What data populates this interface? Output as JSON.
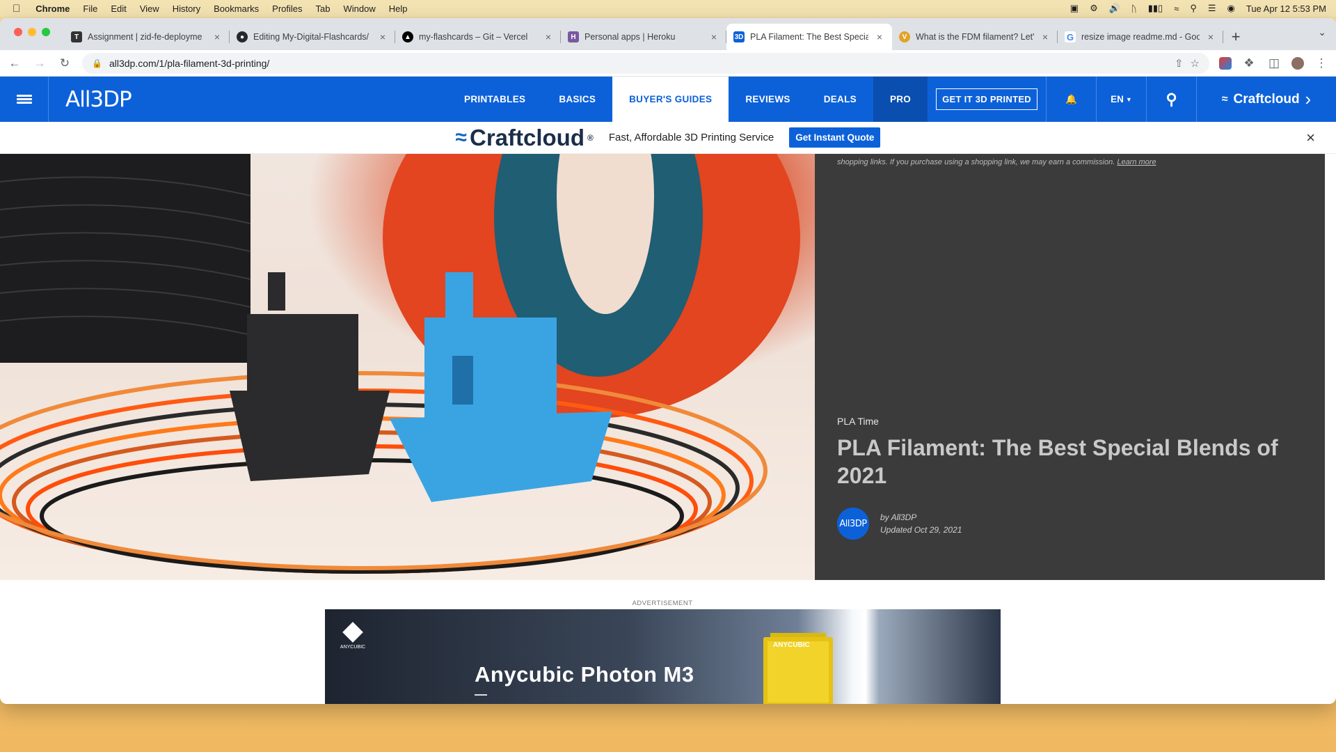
{
  "menubar": {
    "app": "Chrome",
    "items": [
      "File",
      "Edit",
      "View",
      "History",
      "Bookmarks",
      "Profiles",
      "Tab",
      "Window",
      "Help"
    ],
    "clock": "Tue Apr 12  5:53 PM"
  },
  "tabs": [
    {
      "title": "Assignment | zid-fe-deployme",
      "favicon": "notion-icon",
      "color": "#333333"
    },
    {
      "title": "Editing My-Digital-Flashcards/",
      "favicon": "github-icon",
      "color": "#24292f"
    },
    {
      "title": "my-flashcards – Git – Vercel",
      "favicon": "vercel-icon",
      "color": "#000000"
    },
    {
      "title": "Personal apps | Heroku",
      "favicon": "heroku-icon",
      "color": "#79589f"
    },
    {
      "title": "PLA Filament: The Best Specia",
      "favicon": "all3dp-icon",
      "color": "#0c61d9",
      "active": true
    },
    {
      "title": "What is the FDM filament? Let'",
      "favicon": "v-icon",
      "color": "#e2a325"
    },
    {
      "title": "resize image readme.md - Goo",
      "favicon": "google-icon",
      "color": "#4285f4"
    }
  ],
  "address": {
    "url": "all3dp.com/1/pla-filament-3d-printing/"
  },
  "sitenav": {
    "logo": "All3DP",
    "links": [
      "PRINTABLES",
      "BASICS",
      "BUYER'S GUIDES",
      "REVIEWS",
      "DEALS",
      "PRO"
    ],
    "active": "BUYER'S GUIDES",
    "cta": "GET IT 3D PRINTED",
    "language": "EN",
    "craftcloud": "Craftcloud"
  },
  "promo": {
    "brand": "Craftcloud",
    "tagline": "Fast, Affordable 3D Printing Service",
    "cta": "Get Instant Quote"
  },
  "article": {
    "disclaimer": "shopping links. If you purchase using a shopping link, we may earn a commission.",
    "disclaimer_link": "Learn more",
    "kicker": "PLA Time",
    "title": "PLA Filament: The Best Special Blends of 2021",
    "author": "by All3DP",
    "updated": "Updated Oct 29, 2021",
    "avatar": "All3DP"
  },
  "ad": {
    "label": "ADVERTISEMENT",
    "brand": "ANYCUBIC",
    "product": "Anycubic Photon M3",
    "printer_label": "ANYCUBIC"
  }
}
